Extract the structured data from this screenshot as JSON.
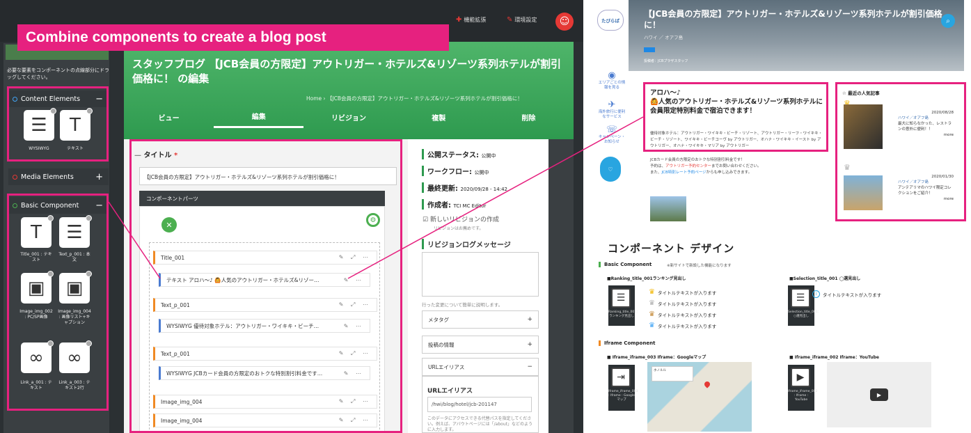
{
  "caption": "Combine components to create a blog post",
  "topbar": {
    "ext_label": "機能拡張",
    "settings_label": "環境設定"
  },
  "sidebar": {
    "desc": "必要な要素をコンポーネントの点線部分にドラッグしてください。",
    "sections": {
      "content": "Content Elements",
      "media": "Media Elements",
      "basic": "Basic Component"
    },
    "content_tiles": [
      {
        "label": "WYSIWYG"
      },
      {
        "label": "テキスト"
      }
    ],
    "basic_tiles": [
      {
        "label": "Title_001 : テキスト"
      },
      {
        "label": "Text_p_001 : 本文"
      },
      {
        "label": "Image_img_002 : PC/SP画像"
      },
      {
        "label": "Image_img_004 : 画像リスト+キャプション"
      },
      {
        "label": "Link_a_001 : テキスト"
      },
      {
        "label": "Link_a_003 : テキスト2行"
      }
    ]
  },
  "main": {
    "page_title": "スタッフブログ 【JCB会員の方限定】アウトリガー・ホテルズ&リゾーツ系列ホテルが割引価格に！ の編集",
    "breadcrumb": "Home › 【JCB会員の方限定】アウトリガー・ホテルズ&リゾーツ系列ホテルが割引価格に！",
    "tabs": [
      "ビュー",
      "編集",
      "リビジョン",
      "複製",
      "削除"
    ],
    "title_label": "タイトル",
    "title_value": "【JCB会員の方限定】アウトリガー・ホテルズ&リゾーツ系列ホテルが割引価格に！",
    "components_label": "コンポーネントパーツ",
    "rows": [
      {
        "text": "Title_001",
        "acts": "✎ ⤢ ⋯"
      },
      {
        "text": "テキスト アロハ〜♪ 🙆人気のアウトリガー・ホテルズ&リゾー…",
        "acts": "✎ ⋯"
      },
      {
        "text": "Text_p_001",
        "acts": "✎ ⤢ ⋯"
      },
      {
        "text": "WYSIWYG 優待対象ホテル：アウトリガー・ワイキキ・ビーチ…",
        "acts": "✎ ⋯"
      },
      {
        "text": "Text_p_001",
        "acts": "✎ ⤢ ⋯"
      },
      {
        "text": "WYSIWYG JCBカード会員の方限定のおトクな特別割引料金です…",
        "acts": "✎ ⋯"
      },
      {
        "text": "Image_img_004",
        "acts": "✎ ⤢ ⋯"
      },
      {
        "text": "Image_img_004",
        "acts": "✎ ⤢ ⋯"
      }
    ]
  },
  "status": {
    "publish": "公開ステータス:",
    "publish_val": "公開中",
    "workflow": "ワークフロー:",
    "workflow_val": "公開中",
    "updated": "最終更新:",
    "updated_val": "2020/09/28 - 14:42",
    "author": "作成者:",
    "author_val": "TCI MC Editor",
    "new_rev": "新しいリビジョンの作成",
    "new_rev_note": "リビジョンはお薦めです。",
    "rev_log": "リビジョンログメッセージ",
    "rev_help": "行った変更について簡単に説明します。",
    "metatag": "メタタグ",
    "post_info": "投稿の情報",
    "url_alias_acc": "URLエイリアス",
    "url_alias": "URLエイリアス",
    "url_value": "/hwi/blog/hotel/jcb-201147",
    "url_help": "このデータにアクセスできる代替パスを指定してください。例えば、アバウトページには「/about」などのように入力します。"
  },
  "blog": {
    "logo": "たびらば",
    "hero_title": "【JCB会員の方限定】アウトリガー・ホテルズ&リゾーツ系列ホテルが割引価格に！",
    "hero_cat": "ハワイ ／ オアフ島",
    "hero_author": "投稿者：JCBプラザスタッフ",
    "nav": [
      {
        "icon": "◉",
        "label": "エリアごとの情報を見る"
      },
      {
        "icon": "✈",
        "label": "海外旅行に便利なサービス"
      },
      {
        "icon": "☏",
        "label": "キャンペーン・お知らせ"
      }
    ],
    "fav_label": "お気に入り",
    "art_heading1": "アロハ〜♪",
    "art_heading2": "🙆人気のアウトリガー・ホテルズ&リゾーツ系列ホテルに会員限定特別料金で宿泊できます！",
    "art_meta": "優待対象ホテル：アウトリガー・ワイキキ・ビーチ・リゾート、アウトリガー・リーフ・ワイキキ・ビーチ・リゾート、ワイキキ・ビーチコーヴ by アウトリガー、オハナ・ワイキキ・イースト by アウトリガー、オハナ・ワイキキ・マリア by アウトリガー",
    "art_body1": "JCBカード会員の方限定のおトクな特別割引料金です！",
    "art_body2a": "予約は、",
    "art_body2b": "アウトリガー予約センター",
    "art_body2c": "までお問い合わせください。",
    "art_body3a": "また、",
    "art_body3b": "JCB特別レート予約ページ",
    "art_body3c": "からも申し込みできます。",
    "popular_title": "最近の人気記事",
    "pop": [
      {
        "cat": "ハワイ／オアフ島",
        "date": "2020/08/28",
        "text": "最大に知らなかった、レストランの意外に便利！！",
        "more": "more"
      },
      {
        "cat": "ハワイ／オアフ島",
        "date": "2020/01/30",
        "text": "アンテアリマのハワイ限定コレクションをご紹介！",
        "more": "more"
      }
    ]
  },
  "design": {
    "title": "コンポーネント デザイン",
    "basic": "Basic Component",
    "basic_note": "※新サイトで新設した機能になります",
    "rank_head": "■Ranking_title_001ランキング見出し",
    "sel_head": "■Selection_title_001 ◯選見出し",
    "rank_items": [
      "タイトルテキストが入ります",
      "タイトルテキストが入ります",
      "タイトルテキストが入ります",
      "タイトルテキストが入ります"
    ],
    "sel_item": "タイトルテキストが入ります",
    "rank_tile": "Ranking_title_001：ランキング見出し",
    "sel_tile": "Selection_title_001：○選見出し",
    "iframe": "Iframe Component",
    "if3_head": "■ Iframe_iframe_003 Iframe：Googleマップ",
    "if2_head": "■ Iframe_iframe_002 Iframe：YouTube",
    "if3_tile": "Iframe_iframe_003 : Iframe : Googleマップ",
    "if2_tile": "Iframe_iframe_002 : Iframe : YouTube",
    "map_card": "ホノルル"
  },
  "colors": {
    "accent": "#e6217f",
    "green": "#2e9a4f",
    "blue": "#29a5e0"
  }
}
